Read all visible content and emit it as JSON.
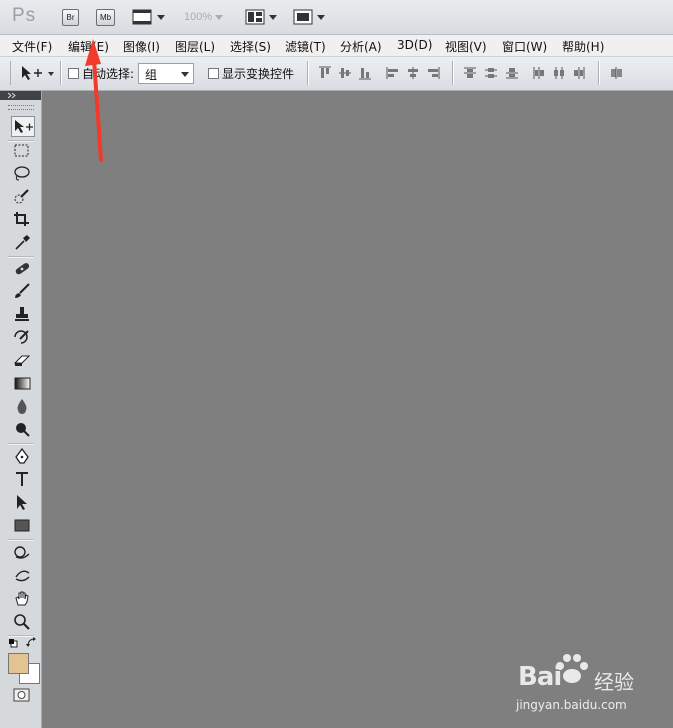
{
  "titlebar": {
    "app_logo": "Ps",
    "bridge_label": "Br",
    "minibridge_label": "Mb",
    "zoom_level": "100%",
    "icons": [
      "bridge-icon",
      "mini-bridge-icon",
      "view-extras-icon",
      "zoom-level-dropdown",
      "arrange-documents-icon",
      "screen-mode-icon"
    ]
  },
  "menu": {
    "items": [
      "文件(F)",
      "编辑(E)",
      "图像(I)",
      "图层(L)",
      "选择(S)",
      "滤镜(T)",
      "分析(A)",
      "3D(D)",
      "视图(V)",
      "窗口(W)",
      "帮助(H)"
    ]
  },
  "options": {
    "auto_select_label": "自动选择:",
    "auto_select_value": "组",
    "show_transform_label": "显示变换控件"
  },
  "tools": [
    "move-tool",
    "rectangular-marquee-tool",
    "lasso-tool",
    "quick-selection-tool",
    "crop-tool",
    "eyedropper-tool",
    "spot-healing-brush-tool",
    "brush-tool",
    "clone-stamp-tool",
    "history-brush-tool",
    "eraser-tool",
    "gradient-tool",
    "blur-tool",
    "dodge-tool",
    "pen-tool",
    "type-tool",
    "path-selection-tool",
    "rectangle-tool",
    "3d-rotate-tool",
    "3d-orbit-tool",
    "hand-tool",
    "zoom-tool"
  ],
  "colors": {
    "foreground": "#e2c391",
    "background": "#ffffff",
    "canvas": "#7f7f7f",
    "annotation_arrow": "#f23a2a"
  },
  "watermark": {
    "logo": "Bai",
    "logo_suffix": "经验",
    "url": "jingyan.baidu.com"
  }
}
